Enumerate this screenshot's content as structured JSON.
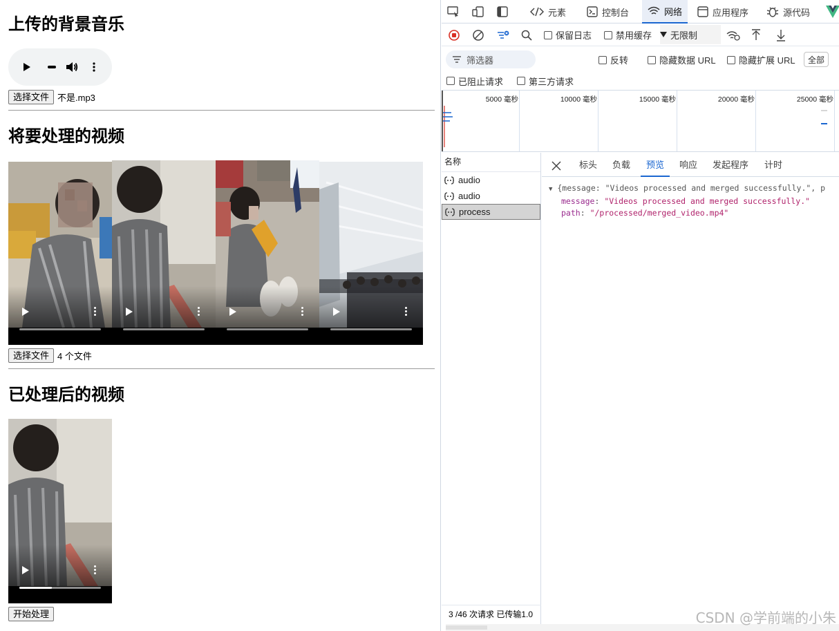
{
  "page": {
    "section_audio_title": "上传的背景音乐",
    "audio_file_button": "选择文件",
    "audio_file_name": "不是.mp3",
    "section_videos_title": "将要处理的视频",
    "videos_file_button": "选择文件",
    "videos_file_count": "4 个文件",
    "section_processed_title": "已处理后的视频",
    "process_button": "开始处理",
    "videos": [
      {
        "progress": 0.0
      },
      {
        "progress": 0.0
      },
      {
        "progress": 0.0
      },
      {
        "progress": 0.0
      }
    ],
    "processed_video": {
      "progress": 0.4
    }
  },
  "devtools": {
    "tabs": [
      "元素",
      "控制台",
      "网络",
      "应用程序",
      "源代码"
    ],
    "active_tab": "网络",
    "toolbar": {
      "preserve_log": "保留日志",
      "disable_cache": "禁用缓存",
      "throttle": "无限制"
    },
    "filter_placeholder": "筛选器",
    "filter_options": {
      "invert": "反转",
      "hide_data_url": "隐藏数据 URL",
      "hide_ext_url": "隐藏扩展 URL",
      "all": "全部",
      "blocked": "已阻止请求",
      "third_party": "第三方请求"
    },
    "timeline_labels": [
      "5000 毫秒",
      "10000 毫秒",
      "15000 毫秒",
      "20000 毫秒",
      "25000 毫秒"
    ],
    "name_header": "名称",
    "requests": [
      {
        "name": "audio",
        "selected": false
      },
      {
        "name": "audio",
        "selected": false
      },
      {
        "name": "process",
        "selected": true
      }
    ],
    "status_text": "3 /46 次请求  已传输1.0",
    "detail_tabs": [
      "标头",
      "负载",
      "预览",
      "响应",
      "发起程序",
      "计时"
    ],
    "active_detail_tab": "预览",
    "preview": {
      "summary": "{message: \"Videos processed and merged successfully.\", p",
      "message_key": "message",
      "message_value": "\"Videos processed and merged successfully.\"",
      "path_key": "path",
      "path_value": "\"/processed/merged_video.mp4\""
    }
  },
  "watermark": "CSDN @学前端的小朱",
  "colors": {
    "accent": "#1a66d0",
    "record_red": "#d93025"
  }
}
